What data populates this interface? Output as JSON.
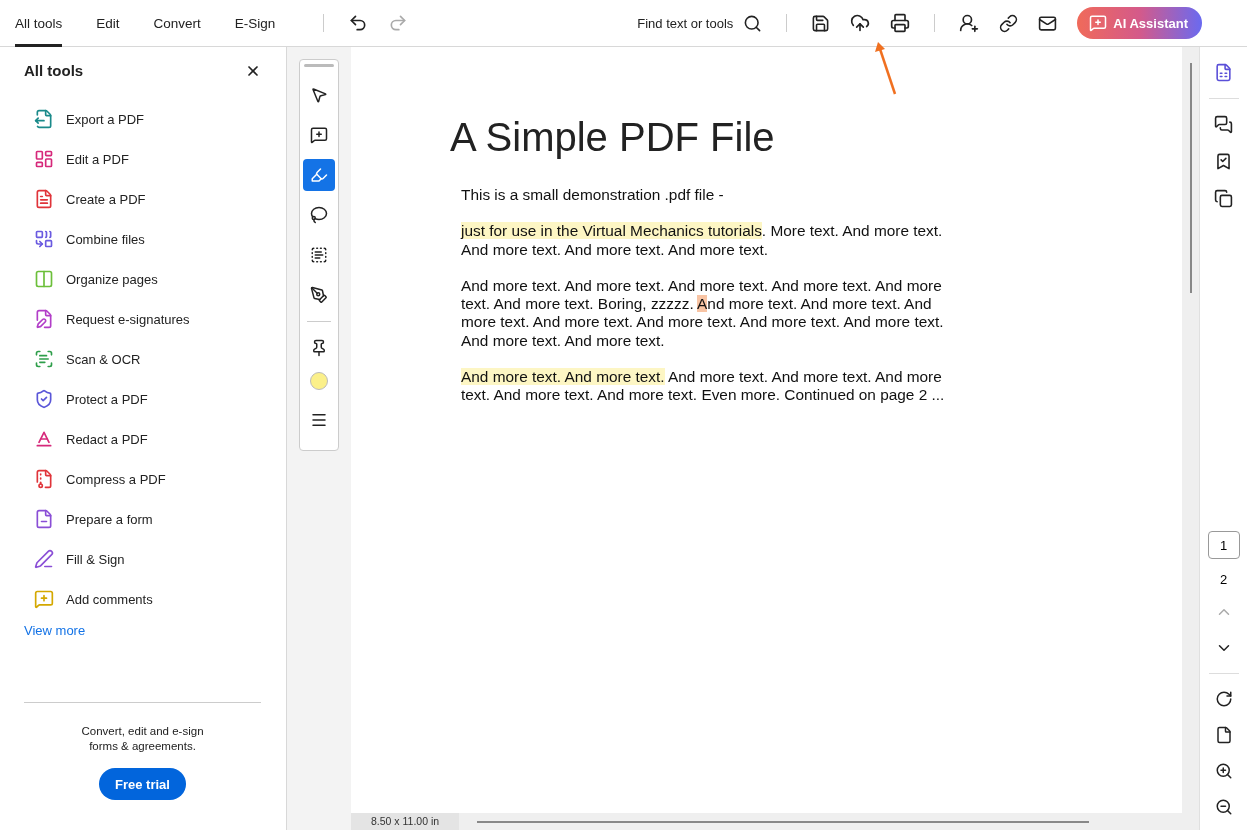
{
  "toolbar": {
    "tabs": [
      {
        "label": "All tools",
        "selected": true
      },
      {
        "label": "Edit",
        "selected": false
      },
      {
        "label": "Convert",
        "selected": false
      },
      {
        "label": "E-Sign",
        "selected": false
      }
    ],
    "history": [
      {
        "kind": "undo",
        "disabled": false
      },
      {
        "kind": "redo",
        "disabled": true
      }
    ],
    "search": {
      "label": "Find text or tools"
    },
    "ai_button": "AI Assistant"
  },
  "sidebar": {
    "title": "All tools",
    "items": [
      {
        "label": "Export a PDF",
        "color": "#1a8a8a"
      },
      {
        "label": "Edit a PDF",
        "color": "#d6287a"
      },
      {
        "label": "Create a PDF",
        "color": "#e0343a"
      },
      {
        "label": "Combine files",
        "color": "#6a5ae0"
      },
      {
        "label": "Organize pages",
        "color": "#6cbf3a"
      },
      {
        "label": "Request e-signatures",
        "color": "#b23ec8"
      },
      {
        "label": "Scan & OCR",
        "color": "#2e9e4a"
      },
      {
        "label": "Protect a PDF",
        "color": "#5a56d8"
      },
      {
        "label": "Redact a PDF",
        "color": "#d6287a"
      },
      {
        "label": "Compress a PDF",
        "color": "#e0343a"
      },
      {
        "label": "Prepare a form",
        "color": "#8a4ed6"
      },
      {
        "label": "Fill & Sign",
        "color": "#8a4ed6"
      },
      {
        "label": "Add comments",
        "color": "#d4a800"
      }
    ],
    "view_more": "View more",
    "promo": {
      "text": "Convert, edit and e-sign forms & agreements.",
      "button": "Free trial"
    }
  },
  "annotation_tools": [
    {
      "kind": "select",
      "selected": false
    },
    {
      "kind": "comment",
      "selected": false
    },
    {
      "kind": "highlight",
      "selected": true
    },
    {
      "kind": "lasso",
      "selected": false
    },
    {
      "kind": "textbox",
      "selected": false
    },
    {
      "kind": "pen",
      "selected": false
    },
    {
      "kind": "divider"
    },
    {
      "kind": "pin",
      "selected": false
    },
    {
      "kind": "swatch",
      "color": "#fbf08a"
    },
    {
      "kind": "menu",
      "selected": false
    }
  ],
  "document": {
    "title": "A Simple PDF File",
    "paragraphs": [
      [
        {
          "text": "This is a small demonstration .pdf file -"
        }
      ],
      [
        {
          "text": "just for use in the Virtual Mechanics tutorials",
          "color": "#fdf6c4"
        },
        {
          "text": ". More text. And more text. And more text. And more text. And more text."
        }
      ],
      [
        {
          "text": "And more text. And more text. And more text. And more text. And more text. And more text. Boring, zzzzz. "
        },
        {
          "text": "A",
          "color": "#f8c4a4"
        },
        {
          "text": "nd more text. And more text. And more text. And more text. And more text. And more text. And more text. And more text. And more text."
        }
      ],
      [
        {
          "text": "And more text. And more text.",
          "color": "#fdf6c4"
        },
        {
          "text": " And more text. And more text. And more text. And more text. And more text. Even more. Continued on page 2 ..."
        }
      ]
    ],
    "page_size": "8.50 x 11.00 in"
  },
  "pages": [
    {
      "label": "1",
      "selected": true
    },
    {
      "label": "2",
      "selected": false
    }
  ]
}
